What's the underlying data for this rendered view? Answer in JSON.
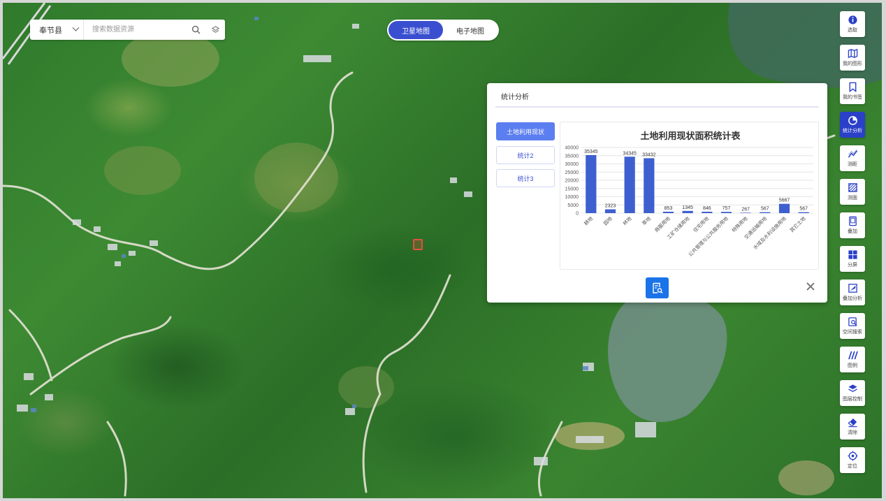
{
  "search": {
    "county": "奉节县",
    "placeholder": "搜索数据资源"
  },
  "map_type": {
    "options": [
      "卫星地图",
      "电子地图"
    ],
    "selected": "卫星地图"
  },
  "toolbar": {
    "items": [
      {
        "label": "选取",
        "icon": "info-icon"
      },
      {
        "label": "我的图形",
        "icon": "map-icon"
      },
      {
        "label": "我的书签",
        "icon": "bookmark-icon"
      },
      {
        "label": "统计分析",
        "icon": "pie-chart-icon",
        "active": true
      },
      {
        "label": "测距",
        "icon": "measure-distance-icon"
      },
      {
        "label": "测面",
        "icon": "measure-area-icon"
      },
      {
        "label": "叠加",
        "icon": "overlay-icon"
      },
      {
        "label": "分屏",
        "icon": "split-screen-icon"
      },
      {
        "label": "叠加分析",
        "icon": "overlay-analysis-icon"
      },
      {
        "label": "空间搜索",
        "icon": "spatial-search-icon"
      },
      {
        "label": "图例",
        "icon": "legend-icon"
      },
      {
        "label": "图层控制",
        "icon": "layers-icon"
      },
      {
        "label": "清除",
        "icon": "eraser-icon"
      },
      {
        "label": "定位",
        "icon": "locate-icon"
      }
    ],
    "accent": "#2a40c8"
  },
  "panel": {
    "title": "统计分析",
    "tabs": [
      "土地利用现状",
      "统计2",
      "统计3"
    ],
    "active_tab": "土地利用现状"
  },
  "chart_data": {
    "type": "bar",
    "title": "土地利用现状面积统计表",
    "categories": [
      "耕地",
      "园地",
      "林地",
      "草地",
      "商服用地",
      "工矿仓储用地",
      "住宅用地",
      "公共管理与公共服务用地",
      "特殊用地",
      "交通运输用地",
      "水域及水利设施用地",
      "其它土地"
    ],
    "values": [
      35345,
      2323,
      34345,
      33432,
      853,
      1345,
      846,
      757,
      267,
      567,
      5667,
      567
    ],
    "ylim": [
      0,
      40000
    ],
    "yticks": [
      0,
      5000,
      10000,
      15000,
      20000,
      25000,
      30000,
      35000,
      40000
    ],
    "grid": true,
    "bar_color": "#3d5fcf"
  }
}
